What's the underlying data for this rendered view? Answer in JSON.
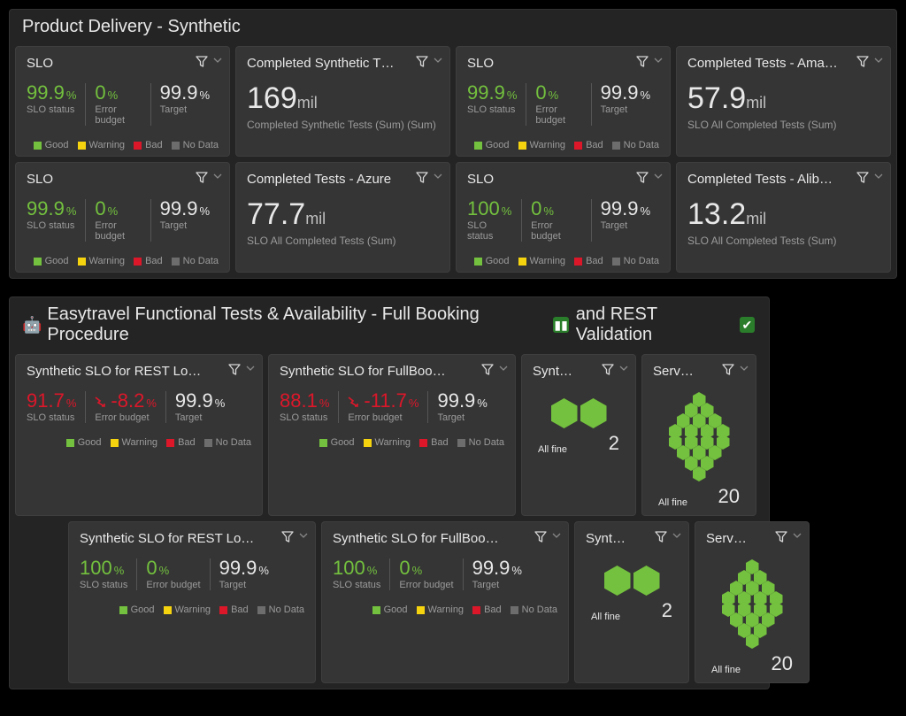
{
  "colors": {
    "green": "#73c13e",
    "red": "#dc172a",
    "yellow": "#f5d30f",
    "grey": "#6d6d6d"
  },
  "legend": {
    "good": "Good",
    "warning": "Warning",
    "bad": "Bad",
    "nodata": "No Data"
  },
  "labels": {
    "slo_status": "SLO status",
    "error_budget": "Error budget",
    "target": "Target",
    "all_fine": "All fine"
  },
  "units": {
    "pct": "%",
    "mil": "mil"
  },
  "dash1": {
    "title": "Product Delivery - Synthetic",
    "tiles": [
      {
        "kind": "slo",
        "title": "SLO",
        "status": "99.9",
        "status_color": "green",
        "budget": "0",
        "budget_color": "green",
        "target": "99.9"
      },
      {
        "kind": "num",
        "title": "Completed Synthetic T…",
        "value": "169",
        "unit": "mil",
        "sub": "Completed Synthetic Tests (Sum) (Sum)"
      },
      {
        "kind": "slo",
        "title": "SLO",
        "status": "99.9",
        "status_color": "green",
        "budget": "0",
        "budget_color": "green",
        "target": "99.9"
      },
      {
        "kind": "num",
        "title": "Completed Tests - Ama…",
        "value": "57.9",
        "unit": "mil",
        "sub": "SLO All Completed Tests (Sum)"
      },
      {
        "kind": "slo",
        "title": "SLO",
        "status": "99.9",
        "status_color": "green",
        "budget": "0",
        "budget_color": "green",
        "target": "99.9"
      },
      {
        "kind": "num",
        "title": "Completed Tests - Azure",
        "value": "77.7",
        "unit": "mil",
        "sub": "SLO All Completed Tests (Sum)"
      },
      {
        "kind": "slo",
        "title": "SLO",
        "status": "100",
        "status_color": "green",
        "budget": "0",
        "budget_color": "green",
        "target": "99.9"
      },
      {
        "kind": "num",
        "title": "Completed Tests - Alib…",
        "value": "13.2",
        "unit": "mil",
        "sub": "SLO All Completed Tests (Sum)"
      }
    ]
  },
  "dash2": {
    "title_prefix": "Easytravel Functional Tests & Availability - Full Booking Procedure",
    "title_mid": "and REST Validation",
    "rows": [
      [
        {
          "kind": "slo",
          "title": "Synthetic SLO for REST Lo…",
          "status": "91.7",
          "status_color": "red",
          "budget": "-8.2",
          "budget_color": "red",
          "budget_trend": true,
          "target": "99.9"
        },
        {
          "kind": "slo",
          "title": "Synthetic SLO for FullBoo…",
          "status": "88.1",
          "status_color": "red",
          "budget": "-11.7",
          "budget_color": "red",
          "budget_trend": true,
          "target": "99.9"
        },
        {
          "kind": "honey",
          "title": "Synt…",
          "shape": "pair",
          "count": "2"
        },
        {
          "kind": "honey",
          "title": "Serv…",
          "shape": "cluster",
          "count": "20"
        }
      ],
      [
        {
          "kind": "slo",
          "title": "Synthetic SLO for REST Lo…",
          "status": "100",
          "status_color": "green",
          "budget": "0",
          "budget_color": "green",
          "target": "99.9"
        },
        {
          "kind": "slo",
          "title": "Synthetic SLO for FullBoo…",
          "status": "100",
          "status_color": "green",
          "budget": "0",
          "budget_color": "green",
          "target": "99.9"
        },
        {
          "kind": "honey",
          "title": "Synt…",
          "shape": "pair",
          "count": "2"
        },
        {
          "kind": "honey",
          "title": "Serv…",
          "shape": "cluster",
          "count": "20"
        }
      ]
    ]
  }
}
